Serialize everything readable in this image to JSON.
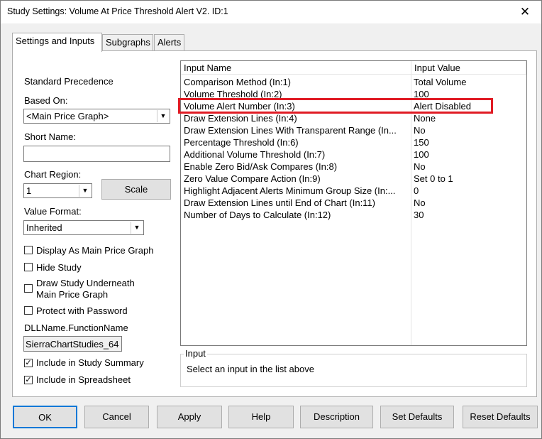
{
  "window": {
    "title": "Study Settings: Volume At Price Threshold Alert V2. ID:1",
    "close_glyph": "✕"
  },
  "tabs": [
    {
      "label": "Settings and Inputs",
      "active": true
    },
    {
      "label": "Subgraphs",
      "active": false
    },
    {
      "label": "Alerts",
      "active": false
    }
  ],
  "left": {
    "standard_precedence": "Standard Precedence",
    "based_on_label": "Based On:",
    "based_on_value": "<Main Price Graph>",
    "short_name_label": "Short Name:",
    "short_name_value": "",
    "chart_region_label": "Chart Region:",
    "chart_region_value": "1",
    "scale_button": "Scale",
    "value_format_label": "Value Format:",
    "value_format_value": "Inherited",
    "checkboxes": [
      {
        "label": "Display As Main Price Graph",
        "checked": false
      },
      {
        "label": "Hide Study",
        "checked": false
      },
      {
        "label": "Draw Study Underneath",
        "label2": "Main Price Graph",
        "checked": false
      },
      {
        "label": "Protect with Password",
        "checked": false
      }
    ],
    "dll_label": "DLLName.FunctionName",
    "dll_value": "SierraChartStudies_64",
    "include_summary": {
      "label": "Include in Study Summary",
      "checked": true
    },
    "include_spreadsheet": {
      "label": "Include in Spreadsheet",
      "checked": true
    },
    "check_glyph": "✓"
  },
  "grid": {
    "col_name": "Input Name",
    "col_value": "Input Value",
    "rows": [
      {
        "name": "Comparison Method   (In:1)",
        "value": "Total Volume"
      },
      {
        "name": "Volume Threshold   (In:2)",
        "value": "100"
      },
      {
        "name": "Volume Alert Number   (In:3)",
        "value": "Alert Disabled"
      },
      {
        "name": "Draw Extension Lines   (In:4)",
        "value": "None"
      },
      {
        "name": "Draw Extension Lines With Transparent Range   (In...",
        "value": "No"
      },
      {
        "name": "Percentage Threshold   (In:6)",
        "value": "150"
      },
      {
        "name": "Additional Volume Threshold   (In:7)",
        "value": "100"
      },
      {
        "name": "Enable Zero Bid/Ask Compares   (In:8)",
        "value": "No"
      },
      {
        "name": "Zero Value Compare Action   (In:9)",
        "value": "Set 0 to 1"
      },
      {
        "name": "Highlight Adjacent Alerts Minimum Group Size   (In:...",
        "value": "0"
      },
      {
        "name": "Draw Extension Lines until End of Chart   (In:11)",
        "value": "No"
      },
      {
        "name": "Number of Days to Calculate   (In:12)",
        "value": "30"
      }
    ],
    "highlight_color": "#e01b24"
  },
  "input_box": {
    "title": "Input",
    "text": "Select an input in the list above"
  },
  "buttons": {
    "ok": "OK",
    "cancel": "Cancel",
    "apply": "Apply",
    "help": "Help",
    "description": "Description",
    "set_defaults": "Set Defaults",
    "reset_defaults": "Reset Defaults"
  },
  "arrow_glyph": "▼"
}
